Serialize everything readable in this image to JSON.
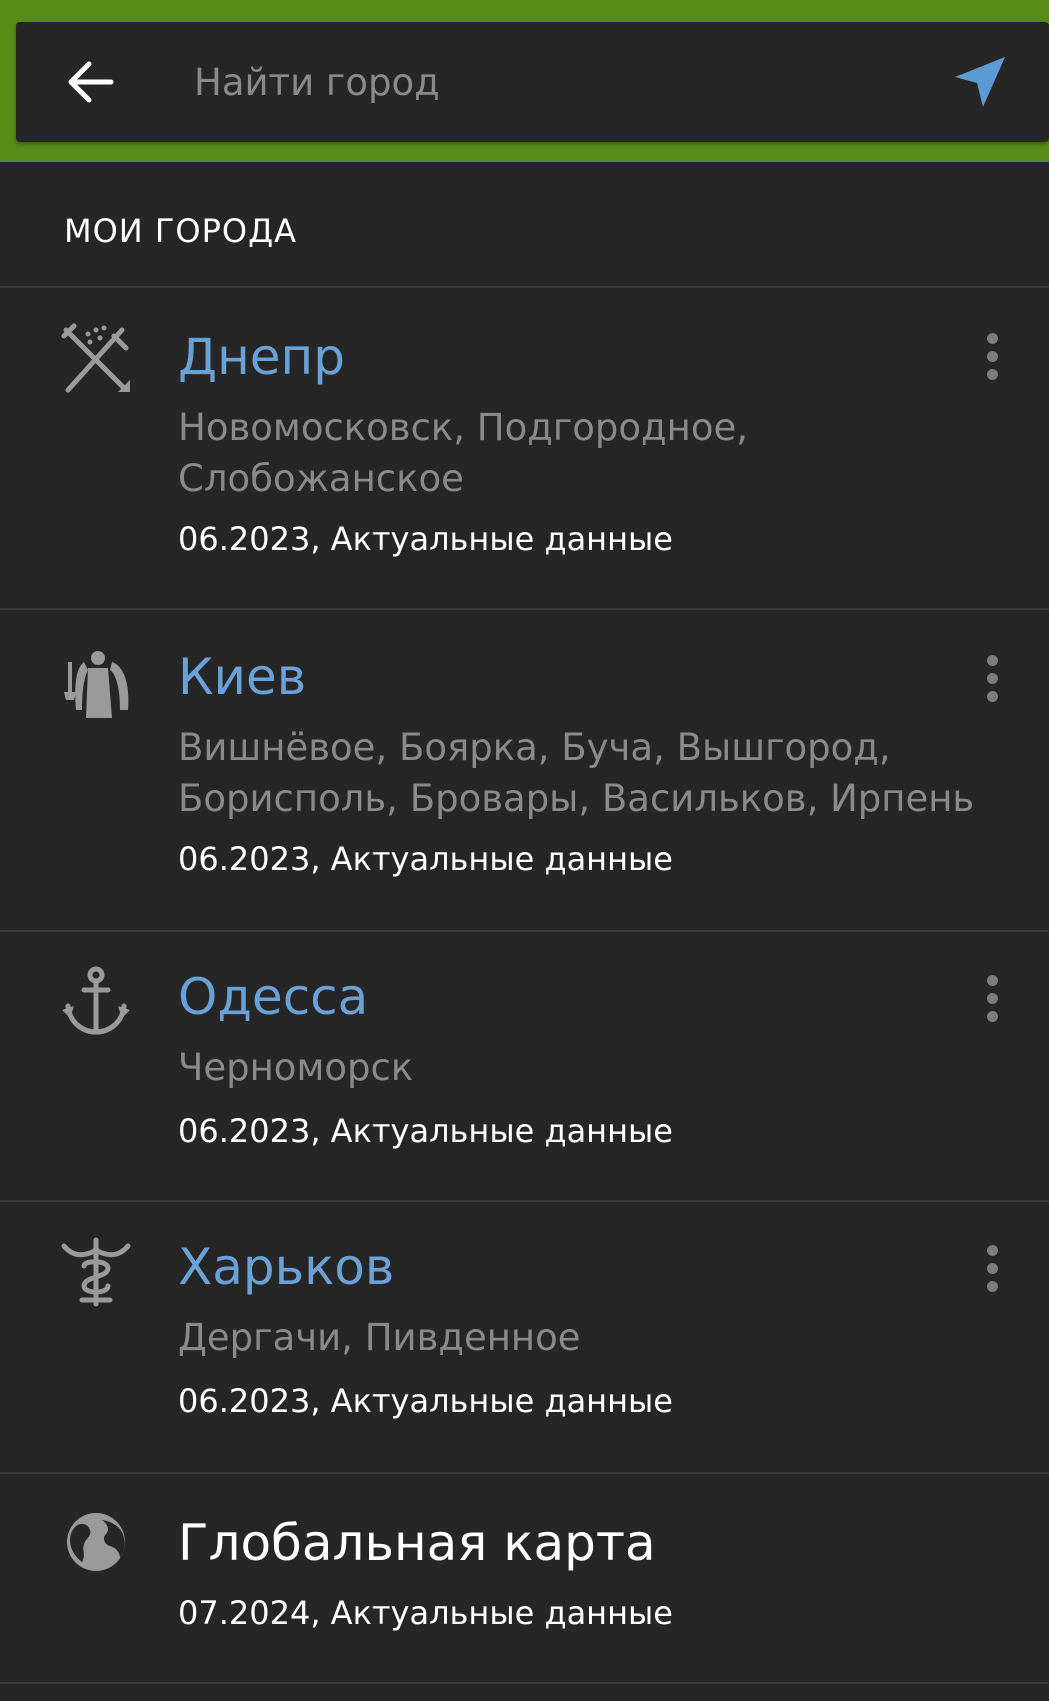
{
  "search": {
    "placeholder": "Найти город"
  },
  "section": {
    "title": "МОИ ГОРОДА"
  },
  "icons": {
    "back": "arrow-left-icon",
    "location": "navigation-arrow-icon",
    "more": "more-vertical-icon"
  },
  "colors": {
    "accent_green": "#5a8c1a",
    "link_blue": "#6aa2d8",
    "location_blue": "#5b9bd5",
    "background": "#262626"
  },
  "cities": [
    {
      "name": "Днепр",
      "icon": "crossed-swords-icon",
      "suburbs": "Новомосковск, Подгородное, Слобожанское",
      "meta": "06.2023, Актуальные данные"
    },
    {
      "name": "Киев",
      "icon": "archangel-icon",
      "suburbs": "Вишнёвое, Боярка, Буча, Вышгород, Борисполь, Бровары, Васильков, Ирпень",
      "meta": "06.2023, Актуальные данные"
    },
    {
      "name": "Одесса",
      "icon": "anchor-icon",
      "suburbs": "Черноморск",
      "meta": "06.2023, Актуальные данные"
    },
    {
      "name": "Харьков",
      "icon": "caduceus-icon",
      "suburbs": "Дергачи, Пивденное",
      "meta": "06.2023, Актуальные данные"
    }
  ],
  "global_map": {
    "name": "Глобальная карта",
    "icon": "globe-icon",
    "meta": "07.2024, Актуальные данные"
  }
}
